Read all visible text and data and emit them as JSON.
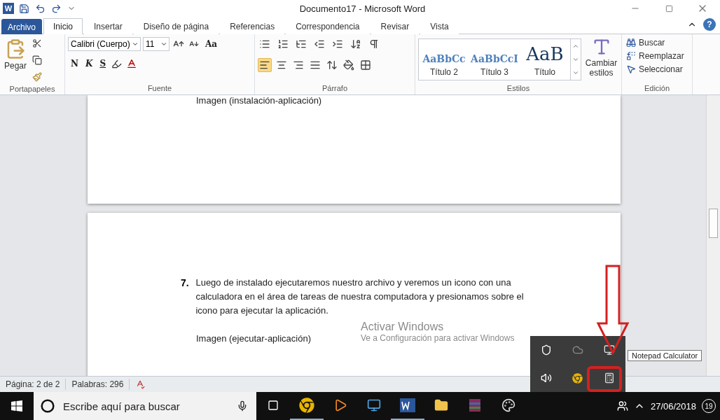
{
  "window": {
    "logo": "W",
    "title": "Documento17 - Microsoft Word",
    "help": "?"
  },
  "tabs": [
    {
      "label": "Archivo",
      "kind": "file",
      "selected": false
    },
    {
      "label": "Inicio",
      "kind": "tab",
      "selected": true
    },
    {
      "label": "Insertar",
      "kind": "tab",
      "selected": false
    },
    {
      "label": "Diseño de página",
      "kind": "tab",
      "selected": false
    },
    {
      "label": "Referencias",
      "kind": "tab",
      "selected": false
    },
    {
      "label": "Correspondencia",
      "kind": "tab",
      "selected": false
    },
    {
      "label": "Revisar",
      "kind": "tab",
      "selected": false
    },
    {
      "label": "Vista",
      "kind": "tab",
      "selected": false
    }
  ],
  "ribbon": {
    "clipboard": {
      "paste": "Pegar",
      "label": "Portapapeles"
    },
    "font": {
      "name": "Calibri (Cuerpo)",
      "size": "11",
      "case": "Aa",
      "style_buttons": [
        "N",
        "K",
        "S"
      ],
      "label": "Fuente"
    },
    "paragraph": {
      "label": "Párrafo",
      "align_buttons": [
        {
          "kind": "left",
          "selected": true
        },
        {
          "kind": "center",
          "selected": false
        },
        {
          "kind": "right",
          "selected": false
        },
        {
          "kind": "justify",
          "selected": false
        }
      ]
    },
    "styles": {
      "label": "Estilos",
      "items": [
        {
          "sample": "AaBbCc",
          "name": "Título 2",
          "kind": "small"
        },
        {
          "sample": "AaBbCcI",
          "name": "Título 3",
          "kind": "small"
        },
        {
          "sample": "AaB",
          "name": "Título",
          "kind": "large"
        }
      ],
      "change": "Cambiar estilos"
    },
    "editing": {
      "label": "Edición",
      "items": [
        {
          "label": "Buscar",
          "kind": "find"
        },
        {
          "label": "Reemplazar",
          "kind": "replace"
        },
        {
          "label": "Seleccionar",
          "kind": "select"
        }
      ]
    }
  },
  "document": {
    "page_1_text": "Imagen (instalación-aplicación)",
    "list_number": "7.",
    "paragraph": "Luego de instalado ejecutaremos nuestro archivo y veremos un icono con una calculadora en el área de tareas de nuestra computadora y presionamos sobre el icono para ejecutar la aplicación.",
    "caption": "Imagen (ejecutar-aplicación)"
  },
  "status_bar": {
    "items": [
      "Página: 2 de 2",
      "Palabras: 296"
    ]
  },
  "activation": {
    "title": "Activar Windows",
    "text": "Ve a Configuración para activar Windows"
  },
  "tray_popup": {
    "tooltip": "Notepad Calculator"
  },
  "taskbar": {
    "search_placeholder": "Escribe aquí para buscar",
    "date": "27/06/2018",
    "notifications": "19"
  }
}
